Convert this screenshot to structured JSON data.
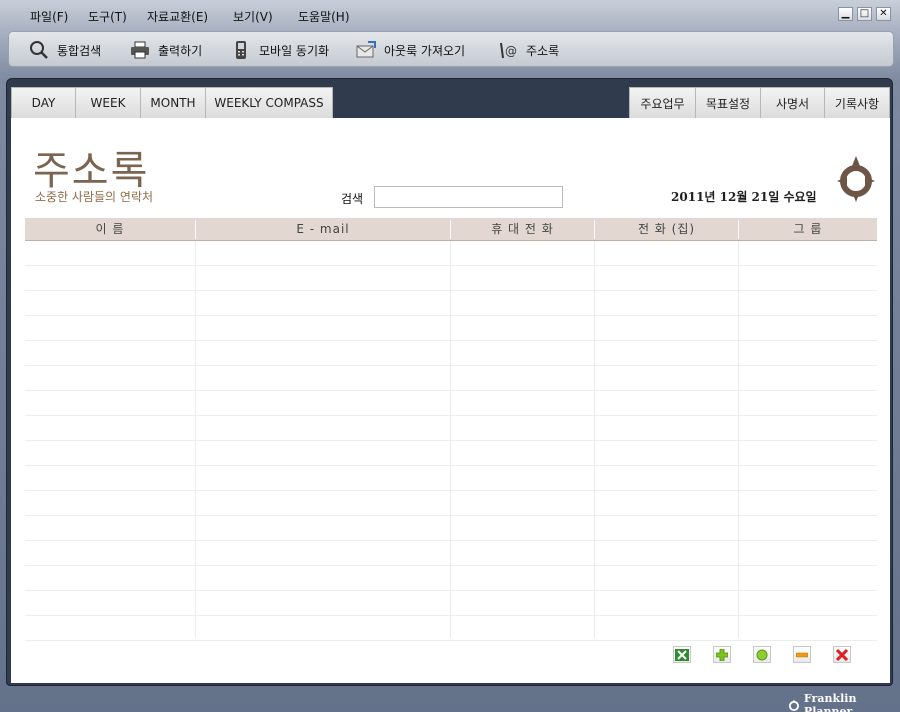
{
  "menu": [
    "파일(F)",
    "도구(T)",
    "자료교환(E)",
    "보기(V)",
    "도움말(H)"
  ],
  "window_controls": {
    "minimize": "▁",
    "maximize": "□",
    "close": "✕"
  },
  "toolbar": [
    {
      "label": "통합검색",
      "icon": "search-icon"
    },
    {
      "label": "출력하기",
      "icon": "printer-icon"
    },
    {
      "label": "모바일 동기화",
      "icon": "mobile-phone-icon"
    },
    {
      "label": "아웃룩 가져오기",
      "icon": "outlook-import-icon"
    },
    {
      "label": "주소록",
      "icon": "address-book-icon"
    }
  ],
  "tabs_left": [
    "DAY",
    "WEEK",
    "MONTH",
    "WEEKLY COMPASS"
  ],
  "tabs_right": [
    "주요업무",
    "목표설정",
    "사명서",
    "기록사항"
  ],
  "page": {
    "title": "주소록",
    "subtitle": "소중한 사람들의 연락처",
    "search_label": "검색",
    "search_value": "",
    "date": "2011년 12월 21일 수요일"
  },
  "table": {
    "columns": [
      "이 름",
      "E - mail",
      "휴 대 전 화",
      "전 화 (집)",
      "그 룹"
    ],
    "rows": []
  },
  "actions": [
    {
      "name": "excel-export",
      "icon": "excel-icon",
      "color": "#2e8b2e"
    },
    {
      "name": "add",
      "icon": "plus-icon",
      "color": "#7cc221"
    },
    {
      "name": "edit",
      "icon": "circle-icon",
      "color": "#8ccf2f"
    },
    {
      "name": "remove",
      "icon": "minus-icon",
      "color": "#f09a14"
    },
    {
      "name": "delete",
      "icon": "x-icon",
      "color": "#e02020"
    }
  ],
  "footer": {
    "brand": "Franklin Planner"
  }
}
